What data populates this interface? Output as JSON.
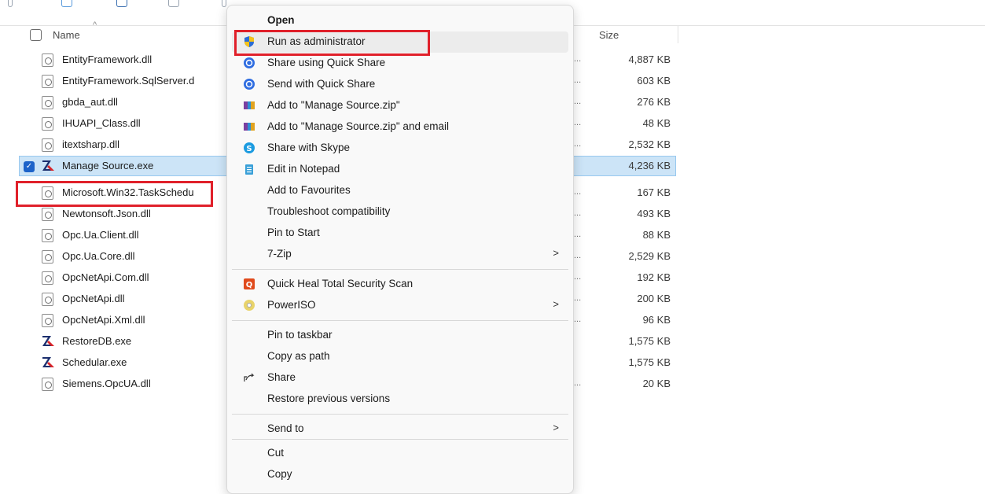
{
  "header": {
    "name_label": "Name",
    "size_label": "Size"
  },
  "files": [
    {
      "name": "EntityFramework.dll",
      "size": "4,887 KB",
      "icon": "dll-file-icon",
      "dots": "..."
    },
    {
      "name": "EntityFramework.SqlServer.d",
      "size": "603 KB",
      "icon": "dll-file-icon",
      "dots": "..."
    },
    {
      "name": "gbda_aut.dll",
      "size": "276 KB",
      "icon": "dll-file-icon",
      "dots": "..."
    },
    {
      "name": "IHUAPI_Class.dll",
      "size": "48 KB",
      "icon": "dll-file-icon",
      "dots": "..."
    },
    {
      "name": "itextsharp.dll",
      "size": "2,532 KB",
      "icon": "dll-file-icon",
      "dots": "..."
    },
    {
      "name": "Manage Source.exe",
      "size": "4,236 KB",
      "icon": "exe-app-icon",
      "dots": ""
    },
    {
      "name": "Microsoft.Win32.TaskSchedu",
      "size": "167 KB",
      "icon": "dll-file-icon",
      "dots": "..."
    },
    {
      "name": "Newtonsoft.Json.dll",
      "size": "493 KB",
      "icon": "dll-file-icon",
      "dots": "..."
    },
    {
      "name": "Opc.Ua.Client.dll",
      "size": "88 KB",
      "icon": "dll-file-icon",
      "dots": "..."
    },
    {
      "name": "Opc.Ua.Core.dll",
      "size": "2,529 KB",
      "icon": "dll-file-icon",
      "dots": "..."
    },
    {
      "name": "OpcNetApi.Com.dll",
      "size": "192 KB",
      "icon": "dll-file-icon",
      "dots": "..."
    },
    {
      "name": "OpcNetApi.dll",
      "size": "200 KB",
      "icon": "dll-file-icon",
      "dots": "..."
    },
    {
      "name": "OpcNetApi.Xml.dll",
      "size": "96 KB",
      "icon": "dll-file-icon",
      "dots": "..."
    },
    {
      "name": "RestoreDB.exe",
      "size": "1,575 KB",
      "icon": "exe-app-icon",
      "dots": ""
    },
    {
      "name": "Schedular.exe",
      "size": "1,575 KB",
      "icon": "exe-app-icon",
      "dots": ""
    },
    {
      "name": "Siemens.OpcUA.dll",
      "size": "20 KB",
      "icon": "dll-file-icon",
      "dots": "..."
    }
  ],
  "context_menu": {
    "items": [
      {
        "label": "Open",
        "icon": "",
        "bold": true
      },
      {
        "label": "Run as administrator",
        "icon": "uac-shield-icon"
      },
      {
        "label": "Share using Quick Share",
        "icon": "quick-share-icon"
      },
      {
        "label": "Send with Quick Share",
        "icon": "quick-share-icon"
      },
      {
        "label": "Add to \"Manage Source.zip\"",
        "icon": "winrar-icon"
      },
      {
        "label": "Add to \"Manage Source.zip\" and email",
        "icon": "winrar-icon"
      },
      {
        "label": "Share with Skype",
        "icon": "skype-icon"
      },
      {
        "label": "Edit in Notepad",
        "icon": "notepad-icon"
      },
      {
        "label": "Add to Favourites",
        "icon": ""
      },
      {
        "label": "Troubleshoot compatibility",
        "icon": ""
      },
      {
        "label": "Pin to Start",
        "icon": ""
      },
      {
        "label": "7-Zip",
        "icon": "",
        "submenu": true
      },
      {
        "label": "Quick Heal Total Security Scan",
        "icon": "quick-heal-icon"
      },
      {
        "label": "PowerISO",
        "icon": "poweriso-icon",
        "submenu": true
      },
      {
        "label": "Pin to taskbar",
        "icon": ""
      },
      {
        "label": "Copy as path",
        "icon": ""
      },
      {
        "label": "Share",
        "icon": "share-icon"
      },
      {
        "label": "Restore previous versions",
        "icon": ""
      },
      {
        "label": "Send to",
        "icon": "",
        "submenu": true
      },
      {
        "label": "Cut",
        "icon": ""
      },
      {
        "label": "Copy",
        "icon": ""
      }
    ],
    "submenu_arrow": ">"
  },
  "colors": {
    "highlight_red": "#e0202a",
    "selection_bg": "#cce4f7",
    "accent_blue": "#1d63c9"
  }
}
